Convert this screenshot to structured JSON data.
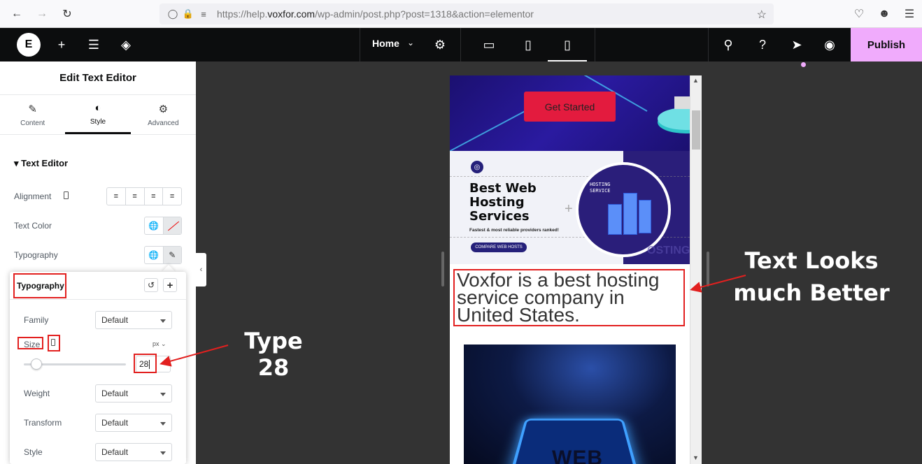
{
  "browser": {
    "url_prefix": "https://help.",
    "url_domain": "voxfor.com",
    "url_path": "/wp-admin/post.php?post=1318&action=elementor"
  },
  "topbar": {
    "page_selector": "Home",
    "publish_label": "Publish"
  },
  "panel": {
    "title": "Edit Text Editor",
    "tabs": [
      {
        "label": "Content",
        "icon": "pencil-icon"
      },
      {
        "label": "Style",
        "icon": "contrast-icon"
      },
      {
        "label": "Advanced",
        "icon": "gear-icon"
      }
    ],
    "active_tab": "Style",
    "section_title": "Text Editor",
    "controls": {
      "alignment": "Alignment",
      "text_color": "Text Color",
      "typography": "Typography"
    }
  },
  "typography_popup": {
    "title": "Typography",
    "family_label": "Family",
    "family_value": "Default",
    "size_label": "Size",
    "size_unit": "px",
    "size_value": "28",
    "weight_label": "Weight",
    "weight_value": "Default",
    "transform_label": "Transform",
    "transform_value": "Default",
    "style_label": "Style",
    "style_value": "Default"
  },
  "preview": {
    "hero_button": "Get Started",
    "banner_title": "Best Web Hosting Services",
    "banner_subtitle": "Fastest & most reliable providers ranked!",
    "banner_cta": "COMPARE WEB HOSTS",
    "banner_circle_label": "HOSTING SERVICE",
    "banner_bg_text": "OSTING",
    "text_editor_content": "Voxfor is a best hosting service company in United States.",
    "image2_text": "WEB"
  },
  "annotations": {
    "type_hint": "Type 28",
    "result_hint": "Text Looks much Better"
  },
  "colors": {
    "publish_bg": "#f0abfc",
    "annotation_red": "#e2201f",
    "hero_button": "#e31b3e"
  }
}
